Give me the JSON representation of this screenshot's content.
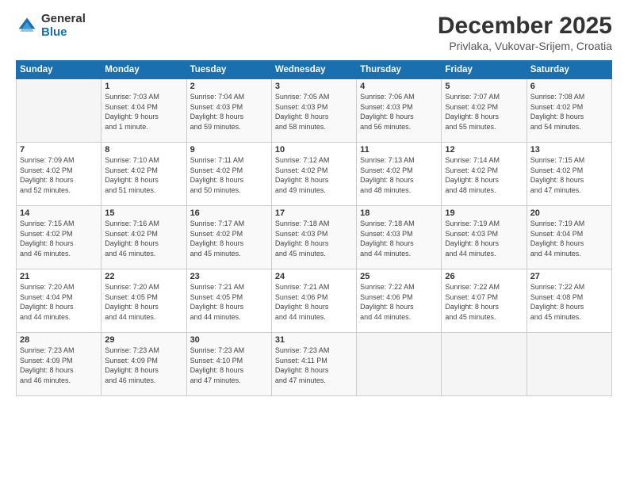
{
  "header": {
    "logo_general": "General",
    "logo_blue": "Blue",
    "month_title": "December 2025",
    "location": "Privlaka, Vukovar-Srijem, Croatia"
  },
  "weekdays": [
    "Sunday",
    "Monday",
    "Tuesday",
    "Wednesday",
    "Thursday",
    "Friday",
    "Saturday"
  ],
  "weeks": [
    [
      {
        "day": "",
        "info": ""
      },
      {
        "day": "1",
        "info": "Sunrise: 7:03 AM\nSunset: 4:04 PM\nDaylight: 9 hours\nand 1 minute."
      },
      {
        "day": "2",
        "info": "Sunrise: 7:04 AM\nSunset: 4:03 PM\nDaylight: 8 hours\nand 59 minutes."
      },
      {
        "day": "3",
        "info": "Sunrise: 7:05 AM\nSunset: 4:03 PM\nDaylight: 8 hours\nand 58 minutes."
      },
      {
        "day": "4",
        "info": "Sunrise: 7:06 AM\nSunset: 4:03 PM\nDaylight: 8 hours\nand 56 minutes."
      },
      {
        "day": "5",
        "info": "Sunrise: 7:07 AM\nSunset: 4:02 PM\nDaylight: 8 hours\nand 55 minutes."
      },
      {
        "day": "6",
        "info": "Sunrise: 7:08 AM\nSunset: 4:02 PM\nDaylight: 8 hours\nand 54 minutes."
      }
    ],
    [
      {
        "day": "7",
        "info": "Sunrise: 7:09 AM\nSunset: 4:02 PM\nDaylight: 8 hours\nand 52 minutes."
      },
      {
        "day": "8",
        "info": "Sunrise: 7:10 AM\nSunset: 4:02 PM\nDaylight: 8 hours\nand 51 minutes."
      },
      {
        "day": "9",
        "info": "Sunrise: 7:11 AM\nSunset: 4:02 PM\nDaylight: 8 hours\nand 50 minutes."
      },
      {
        "day": "10",
        "info": "Sunrise: 7:12 AM\nSunset: 4:02 PM\nDaylight: 8 hours\nand 49 minutes."
      },
      {
        "day": "11",
        "info": "Sunrise: 7:13 AM\nSunset: 4:02 PM\nDaylight: 8 hours\nand 48 minutes."
      },
      {
        "day": "12",
        "info": "Sunrise: 7:14 AM\nSunset: 4:02 PM\nDaylight: 8 hours\nand 48 minutes."
      },
      {
        "day": "13",
        "info": "Sunrise: 7:15 AM\nSunset: 4:02 PM\nDaylight: 8 hours\nand 47 minutes."
      }
    ],
    [
      {
        "day": "14",
        "info": "Sunrise: 7:15 AM\nSunset: 4:02 PM\nDaylight: 8 hours\nand 46 minutes."
      },
      {
        "day": "15",
        "info": "Sunrise: 7:16 AM\nSunset: 4:02 PM\nDaylight: 8 hours\nand 46 minutes."
      },
      {
        "day": "16",
        "info": "Sunrise: 7:17 AM\nSunset: 4:02 PM\nDaylight: 8 hours\nand 45 minutes."
      },
      {
        "day": "17",
        "info": "Sunrise: 7:18 AM\nSunset: 4:03 PM\nDaylight: 8 hours\nand 45 minutes."
      },
      {
        "day": "18",
        "info": "Sunrise: 7:18 AM\nSunset: 4:03 PM\nDaylight: 8 hours\nand 44 minutes."
      },
      {
        "day": "19",
        "info": "Sunrise: 7:19 AM\nSunset: 4:03 PM\nDaylight: 8 hours\nand 44 minutes."
      },
      {
        "day": "20",
        "info": "Sunrise: 7:19 AM\nSunset: 4:04 PM\nDaylight: 8 hours\nand 44 minutes."
      }
    ],
    [
      {
        "day": "21",
        "info": "Sunrise: 7:20 AM\nSunset: 4:04 PM\nDaylight: 8 hours\nand 44 minutes."
      },
      {
        "day": "22",
        "info": "Sunrise: 7:20 AM\nSunset: 4:05 PM\nDaylight: 8 hours\nand 44 minutes."
      },
      {
        "day": "23",
        "info": "Sunrise: 7:21 AM\nSunset: 4:05 PM\nDaylight: 8 hours\nand 44 minutes."
      },
      {
        "day": "24",
        "info": "Sunrise: 7:21 AM\nSunset: 4:06 PM\nDaylight: 8 hours\nand 44 minutes."
      },
      {
        "day": "25",
        "info": "Sunrise: 7:22 AM\nSunset: 4:06 PM\nDaylight: 8 hours\nand 44 minutes."
      },
      {
        "day": "26",
        "info": "Sunrise: 7:22 AM\nSunset: 4:07 PM\nDaylight: 8 hours\nand 45 minutes."
      },
      {
        "day": "27",
        "info": "Sunrise: 7:22 AM\nSunset: 4:08 PM\nDaylight: 8 hours\nand 45 minutes."
      }
    ],
    [
      {
        "day": "28",
        "info": "Sunrise: 7:23 AM\nSunset: 4:09 PM\nDaylight: 8 hours\nand 46 minutes."
      },
      {
        "day": "29",
        "info": "Sunrise: 7:23 AM\nSunset: 4:09 PM\nDaylight: 8 hours\nand 46 minutes."
      },
      {
        "day": "30",
        "info": "Sunrise: 7:23 AM\nSunset: 4:10 PM\nDaylight: 8 hours\nand 47 minutes."
      },
      {
        "day": "31",
        "info": "Sunrise: 7:23 AM\nSunset: 4:11 PM\nDaylight: 8 hours\nand 47 minutes."
      },
      {
        "day": "",
        "info": ""
      },
      {
        "day": "",
        "info": ""
      },
      {
        "day": "",
        "info": ""
      }
    ]
  ]
}
